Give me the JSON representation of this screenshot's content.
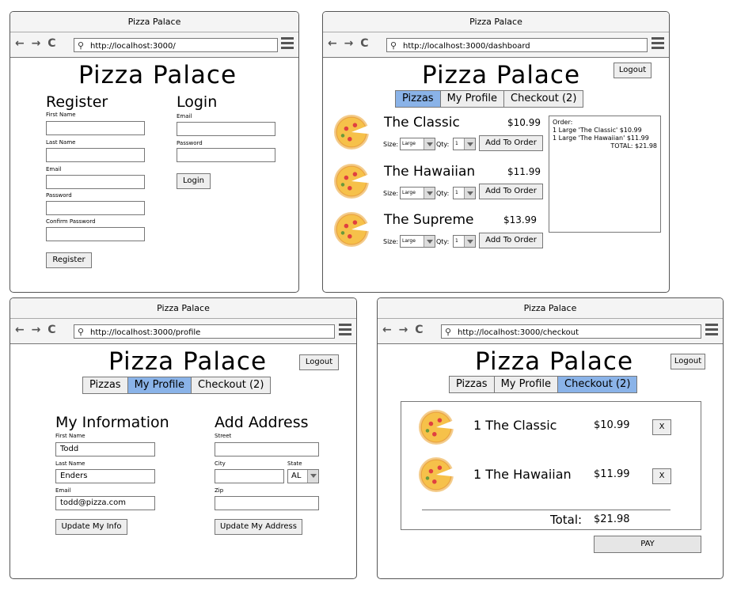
{
  "app_title": "Pizza Palace",
  "brand": "Pizza Palace",
  "nav_glyphs": "← → C",
  "windows": {
    "login": {
      "url": "http://localhost:3000/",
      "register": {
        "heading": "Register",
        "first_name_label": "First Name",
        "last_name_label": "Last Name",
        "email_label": "Email",
        "password_label": "Password",
        "confirm_password_label": "Confirm Password",
        "button": "Register"
      },
      "login": {
        "heading": "Login",
        "email_label": "Email",
        "password_label": "Password",
        "button": "Login"
      }
    },
    "dashboard": {
      "url": "http://localhost:3000/dashboard",
      "logout": "Logout",
      "tabs": [
        "Pizzas",
        "My Profile",
        "Checkout (2)"
      ],
      "active_tab": "Pizzas",
      "size_label": "Size:",
      "qty_label": "Qty:",
      "add_button": "Add To Order",
      "products": [
        {
          "name": "The Classic",
          "price": "$10.99",
          "size": "Large",
          "qty": "1"
        },
        {
          "name": "The Hawaiian",
          "price": "$11.99",
          "size": "Large",
          "qty": "1"
        },
        {
          "name": "The Supreme",
          "price": "$13.99",
          "size": "Large",
          "qty": "1"
        }
      ],
      "order": {
        "heading": "Order:",
        "lines": [
          "1 Large 'The Classic'  $10.99",
          "1 Large 'The Hawaiian' $11.99"
        ],
        "total": "TOTAL: $21.98"
      }
    },
    "profile": {
      "url": "http://localhost:3000/profile",
      "logout": "Logout",
      "tabs": [
        "Pizzas",
        "My Profile",
        "Checkout (2)"
      ],
      "active_tab": "My Profile",
      "info": {
        "heading": "My Information",
        "first_name_label": "First Name",
        "first_name": "Todd",
        "last_name_label": "Last Name",
        "last_name": "Enders",
        "email_label": "Email",
        "email": "todd@pizza.com",
        "button": "Update My Info"
      },
      "address": {
        "heading": "Add Address",
        "street_label": "Street",
        "city_label": "City",
        "state_label": "State",
        "state": "AL",
        "zip_label": "Zip",
        "button": "Update My Address"
      }
    },
    "checkout": {
      "url": "http://localhost:3000/checkout",
      "logout": "Logout",
      "tabs": [
        "Pizzas",
        "My Profile",
        "Checkout (2)"
      ],
      "active_tab": "Checkout (2)",
      "items": [
        {
          "name": "1 The Classic",
          "price": "$10.99",
          "remove": "X"
        },
        {
          "name": "1 The Hawaiian",
          "price": "$11.99",
          "remove": "X"
        }
      ],
      "total_label": "Total:",
      "total": "$21.98",
      "pay": "PAY"
    }
  }
}
